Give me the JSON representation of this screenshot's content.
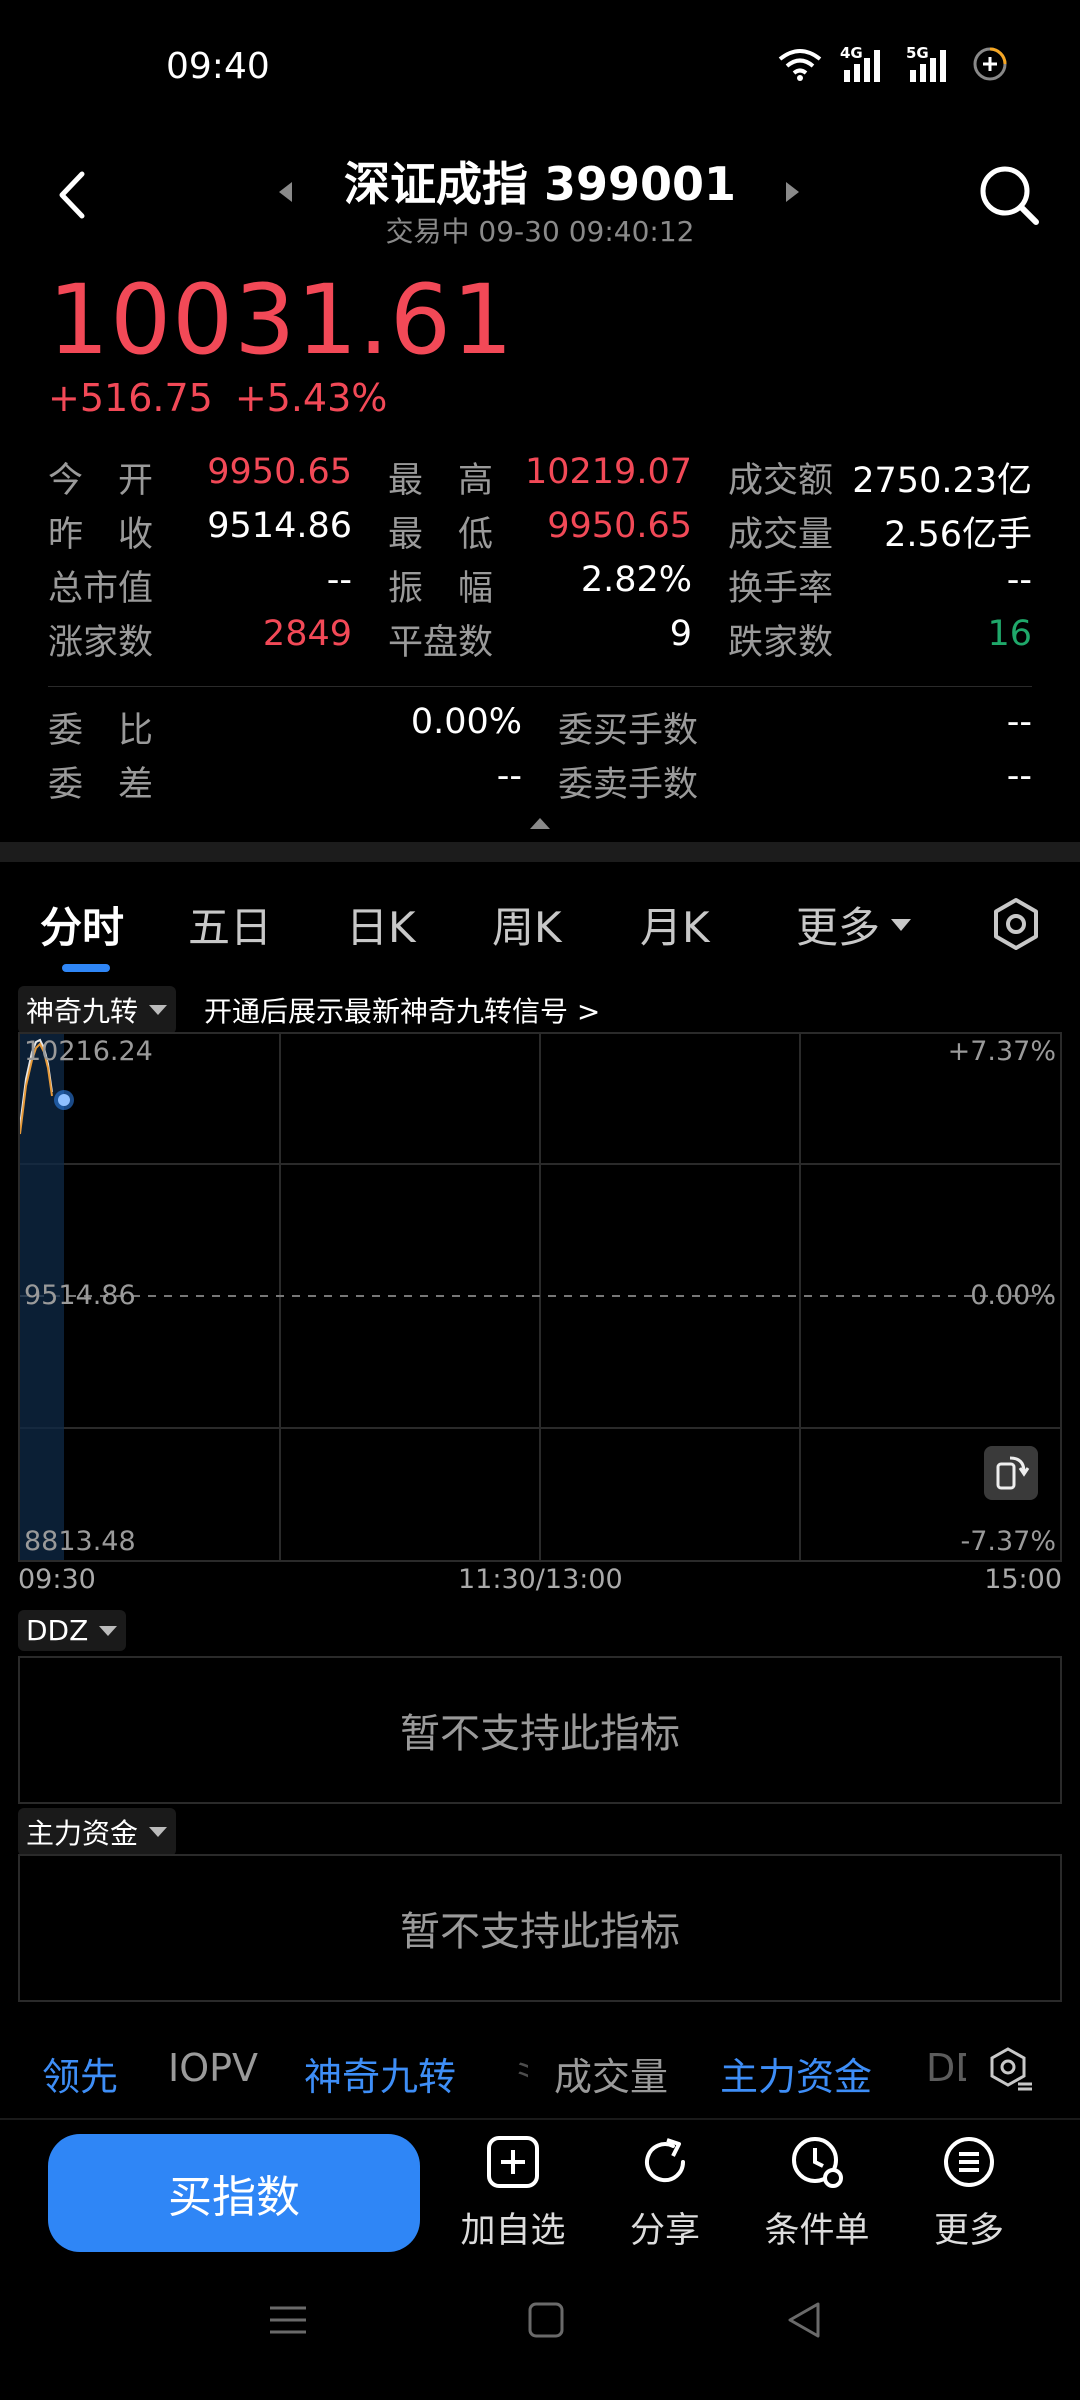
{
  "status": {
    "time": "09:40",
    "net1": "4G",
    "net2": "5G"
  },
  "header": {
    "title": "深证成指 399001",
    "subtitle": "交易中 09-30 09:40:12"
  },
  "quote": {
    "price": "10031.61",
    "change": "+516.75",
    "change_pct": "+5.43%"
  },
  "stats": [
    [
      {
        "label": "今　开",
        "value": "9950.65",
        "color": "red"
      },
      {
        "label": "最　高",
        "value": "10219.07",
        "color": "red"
      },
      {
        "label": "成交额",
        "value": "2750.23亿",
        "color": "white"
      }
    ],
    [
      {
        "label": "昨　收",
        "value": "9514.86",
        "color": "white"
      },
      {
        "label": "最　低",
        "value": "9950.65",
        "color": "red"
      },
      {
        "label": "成交量",
        "value": "2.56亿手",
        "color": "white"
      }
    ],
    [
      {
        "label": "总市值",
        "value": "--",
        "color": "white"
      },
      {
        "label": "振　幅",
        "value": "2.82%",
        "color": "white"
      },
      {
        "label": "换手率",
        "value": "--",
        "color": "white"
      }
    ],
    [
      {
        "label": "涨家数",
        "value": "2849",
        "color": "red"
      },
      {
        "label": "平盘数",
        "value": "9",
        "color": "white"
      },
      {
        "label": "跌家数",
        "value": "16",
        "color": "green"
      }
    ]
  ],
  "order_stats": [
    [
      {
        "label": "委　比",
        "value": "0.00%"
      },
      {
        "label": "委买手数",
        "value": "--"
      }
    ],
    [
      {
        "label": "委　差",
        "value": "--"
      },
      {
        "label": "委卖手数",
        "value": "--"
      }
    ]
  ],
  "tabs": [
    "分时",
    "五日",
    "日K",
    "周K",
    "月K",
    "更多"
  ],
  "chart": {
    "indicator": "神奇九转",
    "tip": "开通后展示最新神奇九转信号 >",
    "y_top": "10216.24",
    "y_mid": "9514.86",
    "y_bottom": "8813.48",
    "pct_top": "+7.37%",
    "pct_mid": "0.00%",
    "pct_bottom": "-7.37%",
    "time_start": "09:30",
    "time_mid": "11:30/13:00",
    "time_end": "15:00"
  },
  "panels": [
    {
      "indicator": "DDZ",
      "message": "暂不支持此指标"
    },
    {
      "indicator": "主力资金",
      "message": "暂不支持此指标"
    }
  ],
  "indicator_tabs": [
    "领先",
    "IOPV",
    "神奇九转",
    "成交量",
    "主力资金",
    "DD"
  ],
  "toolbar": {
    "buy": "买指数",
    "items": [
      "加自选",
      "分享",
      "条件单",
      "更多"
    ]
  },
  "colors": {
    "up": "#f24957",
    "down": "#1fa86a",
    "accent": "#2f86f6"
  }
}
